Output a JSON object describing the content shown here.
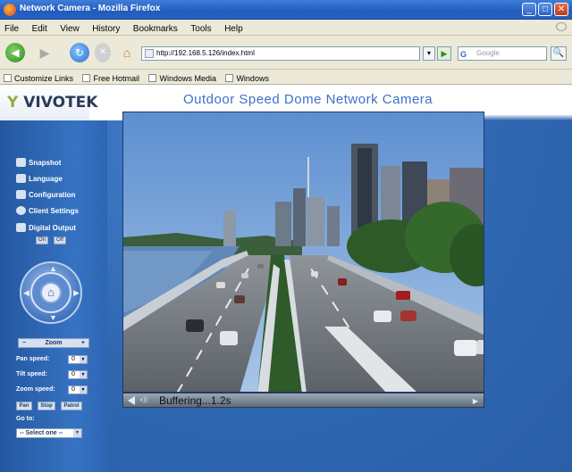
{
  "window": {
    "title": "Network Camera - Mozilla Firefox",
    "buttons": [
      "_",
      "□",
      "✕"
    ]
  },
  "menu": [
    "File",
    "Edit",
    "View",
    "History",
    "Bookmarks",
    "Tools",
    "Help"
  ],
  "nav": {
    "url": "http://192.168.5.126/index.html",
    "go_dropdown": "▾",
    "go_button": "▶",
    "search_engine": "G",
    "search_placeholder": "Google",
    "search_button": "🔍"
  },
  "bookmarks": [
    "Customize Links",
    "Free Hotmail",
    "Windows Media",
    "Windows"
  ],
  "page": {
    "logo_mark": "Y",
    "logo_text": "VIVOTEK",
    "header_title": "Outdoor Speed Dome Network Camera",
    "sidebar": {
      "items": [
        "Snapshot",
        "Language",
        "Configuration",
        "Client Settings",
        "Digital Output"
      ],
      "digital_output_buttons": [
        "On",
        "Off"
      ],
      "zoom_label": "Zoom",
      "zoom_minus": "−",
      "zoom_plus": "+",
      "pan_speed_label": "Pan speed:",
      "pan_speed_value": "0",
      "tilt_speed_label": "Tilt speed:",
      "tilt_speed_value": "0",
      "zoom_speed_label": "Zoom speed:",
      "zoom_speed_value": "0",
      "pan_button": "Pan",
      "stop_button": "Stop",
      "patrol_button": "Patrol",
      "goto_label": "Go to:",
      "goto_select": "-- Select one --"
    },
    "video": {
      "status": "Buffering...1.2s"
    }
  },
  "colors": {
    "page_bg": "#2f67b1",
    "header_text": "#3b71c8",
    "sky": "#7aa7d8",
    "water": "#5f88b8"
  }
}
